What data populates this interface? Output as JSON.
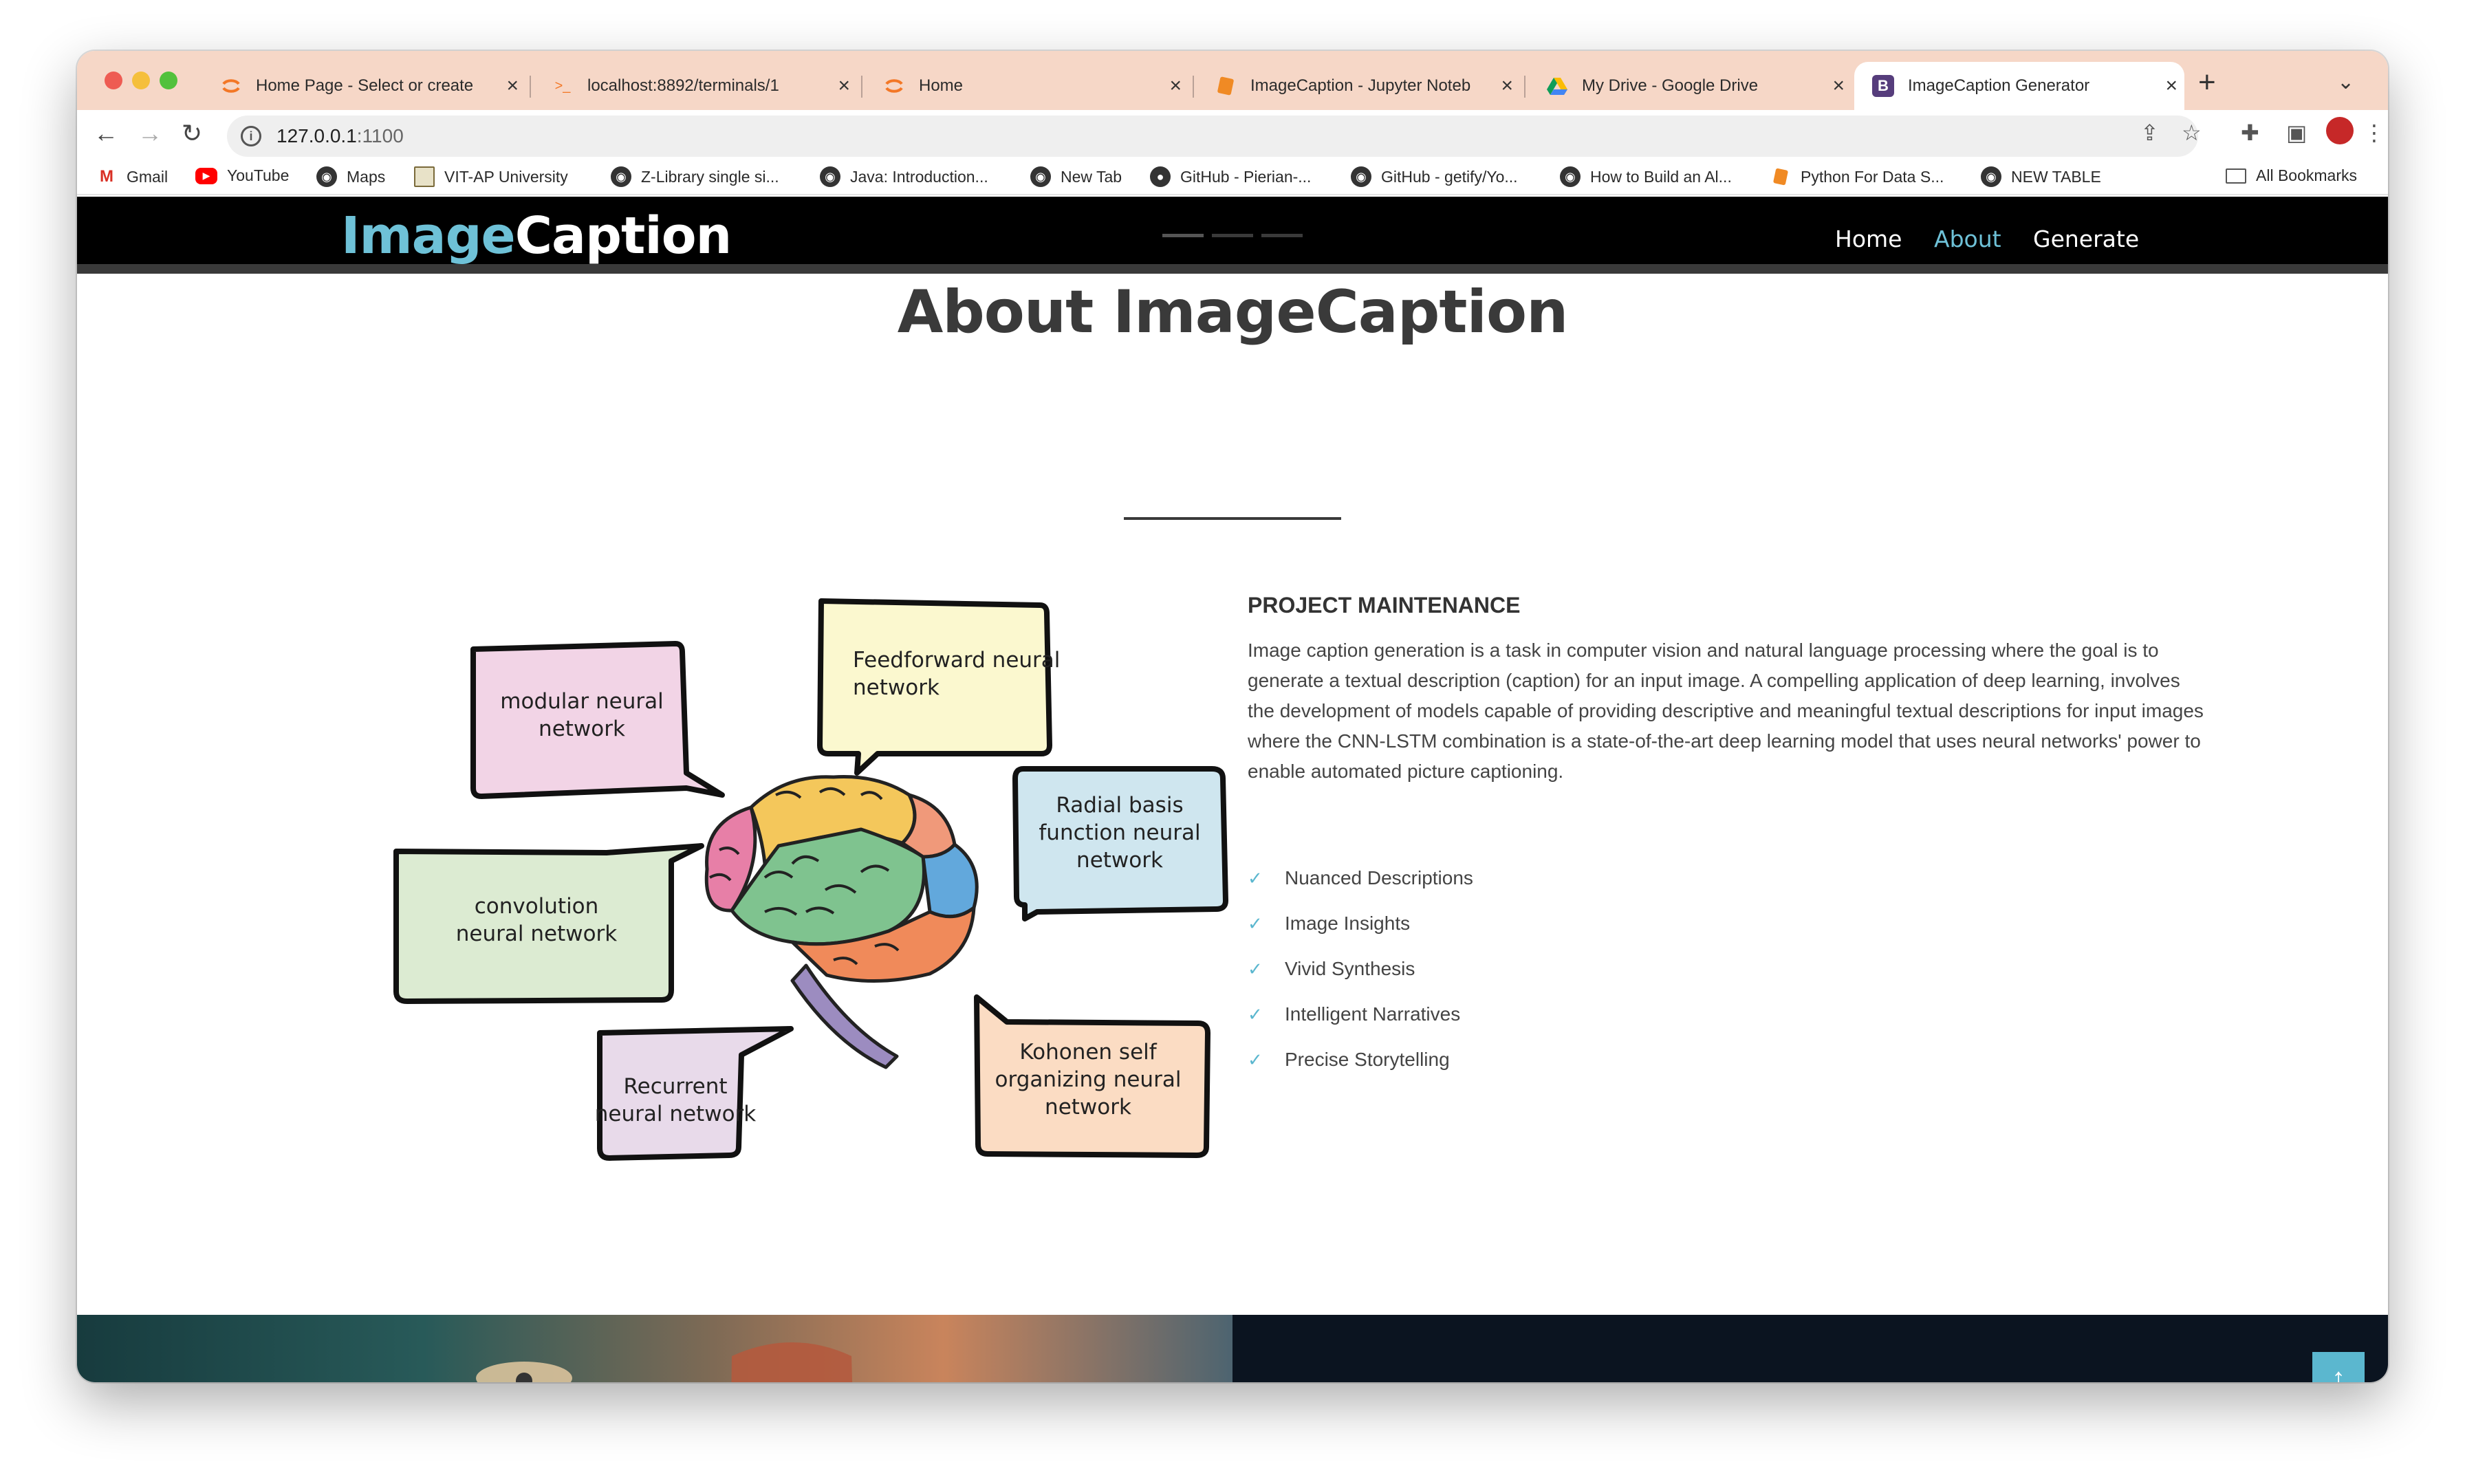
{
  "browser": {
    "tabs": [
      {
        "title": "Home Page - Select or create",
        "favicon": "jupyter-icon",
        "active": false
      },
      {
        "title": "localhost:8892/terminals/1",
        "favicon": "terminal-icon",
        "active": false
      },
      {
        "title": "Home",
        "favicon": "jupyter-icon",
        "active": false
      },
      {
        "title": "ImageCaption - Jupyter Noteb",
        "favicon": "notebook-icon",
        "active": false
      },
      {
        "title": "My Drive - Google Drive",
        "favicon": "google-drive-icon",
        "active": false
      },
      {
        "title": "ImageCaption Generator",
        "favicon": "bootstrap-icon",
        "active": true
      }
    ],
    "favicon_glyphs": {
      "bootstrap": "B",
      "terminal": ">_",
      "plus": "+"
    },
    "url_host": "127.0.0.1",
    "url_port": ":1100",
    "bookmarks": [
      {
        "label": "Gmail",
        "icon": "gmail-icon"
      },
      {
        "label": "YouTube",
        "icon": "youtube-icon"
      },
      {
        "label": "Maps",
        "icon": "globe-icon"
      },
      {
        "label": "VIT-AP University",
        "icon": "vit-icon"
      },
      {
        "label": "Z-Library single si...",
        "icon": "globe-icon"
      },
      {
        "label": "Java: Introduction...",
        "icon": "globe-icon"
      },
      {
        "label": "New Tab",
        "icon": "globe-icon"
      },
      {
        "label": "GitHub - Pierian-...",
        "icon": "github-icon"
      },
      {
        "label": "GitHub - getify/Yo...",
        "icon": "globe-icon"
      },
      {
        "label": "How to Build an Al...",
        "icon": "globe-icon"
      },
      {
        "label": "Python For Data S...",
        "icon": "notebook-icon"
      },
      {
        "label": "NEW TABLE",
        "icon": "globe-icon"
      }
    ],
    "all_bookmarks": "All Bookmarks"
  },
  "site": {
    "brand_part1": "Image",
    "brand_part2": "Caption",
    "nav": {
      "home": "Home",
      "about": "About",
      "generate": "Generate"
    },
    "accent_color": "#6ec1d7"
  },
  "about": {
    "title": "About ImageCaption",
    "diagram": {
      "bubbles": {
        "modular": [
          "modular neural",
          "network"
        ],
        "feedforward": [
          "Feedforward neural",
          "network"
        ],
        "radial": [
          "Radial basis",
          "function neural",
          "network"
        ],
        "convolution": [
          "convolution",
          "neural network"
        ],
        "recurrent": [
          "Recurrent",
          "neural network"
        ],
        "kohonen": [
          "Kohonen self",
          "organizing neural",
          "network"
        ]
      }
    },
    "section_heading": "PROJECT MAINTENANCE",
    "description": "Image caption generation is a task in computer vision and natural language processing where the goal is to generate a textual description (caption) for an input image. A compelling application of deep learning, involves the development of models capable of providing descriptive and meaningful textual descriptions for input images where the CNN-LSTM combination is a state-of-the-art deep learning model that uses neural networks' power to enable automated picture captioning.",
    "features": [
      "Nuanced Descriptions",
      "Image Insights",
      "Vivid Synthesis",
      "Intelligent Narratives",
      "Precise Storytelling"
    ]
  }
}
